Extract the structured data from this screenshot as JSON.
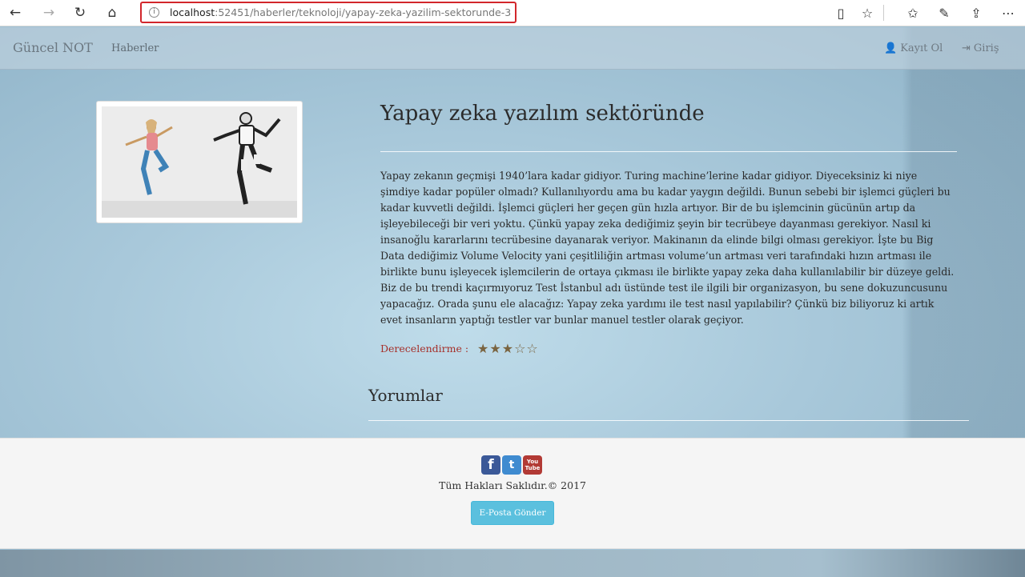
{
  "browser": {
    "url_host": "localhost",
    "url_path": ":52451/haberler/teknoloji/yapay-zeka-yazilim-sektorunde-3",
    "info_glyph": "i",
    "back_glyph": "←",
    "forward_glyph": "→",
    "refresh_glyph": "↻",
    "home_glyph": "⌂",
    "reading_glyph": "▯",
    "favorite_glyph": "☆",
    "favorites_glyph": "✩",
    "pen_glyph": "✎",
    "share_glyph": "⇪",
    "more_glyph": "⋯"
  },
  "navbar": {
    "brand": "Güncel NOT",
    "haberler": "Haberler",
    "register_icon": "👤",
    "register": "Kayıt Ol",
    "login_icon": "⇥",
    "login": "Giriş"
  },
  "article": {
    "title": "Yapay zeka yazılım sektöründe",
    "body": "Yapay zekanın geçmişi 1940’lara kadar gidiyor. Turing machine’lerine kadar gidiyor. Diyeceksiniz ki niye şimdiye kadar popüler olmadı? Kullanılıyordu ama bu kadar yaygın değildi. Bunun sebebi bir işlemci güçleri bu kadar kuvvetli değildi. İşlemci güçleri her geçen gün hızla artıyor. Bir de bu işlemcinin gücünün artıp da işleyebileceği bir veri yoktu. Çünkü yapay zeka dediğimiz şeyin bir tecrübeye dayanması gerekiyor. Nasıl ki insanoğlu kararlarını tecrübesine dayanarak veriyor. Makinanın da elinde bilgi olması gerekiyor. İşte bu Big Data dediğimiz Volume Velocity yani çeşitliliğin artması volume’un artması veri tarafındaki hızın artması ile birlikte bunu işleyecek işlemcilerin de ortaya çıkması ile birlikte yapay zeka daha kullanılabilir bir düzeye geldi. Biz de bu trendi kaçırmıyoruz Test İstanbul adı üstünde test ile ilgili bir organizasyon, bu sene dokuzuncusunu yapacağız. Orada şunu ele alacağız: Yapay zeka yardımı ile test nasıl yapılabilir? Çünkü biz biliyoruz ki artık evet insanların yaptığı testler var bunlar manuel testler olarak geçiyor.",
    "rating_label": "Derecelendirme :",
    "rating_value": 3,
    "rating_max": 5,
    "stars": "★★★☆☆"
  },
  "comments": {
    "heading": "Yorumlar"
  },
  "footer": {
    "facebook_glyph": "f",
    "twitter_glyph": "t",
    "youtube_top": "You",
    "youtube_bottom": "Tube",
    "copyright": "Tüm Hakları Saklıdır.© 2017",
    "email_button": "E-Posta Gönder"
  }
}
